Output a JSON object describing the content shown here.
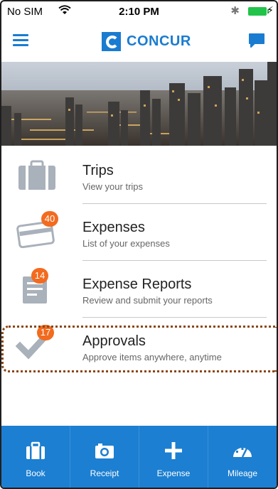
{
  "status_bar": {
    "carrier": "No SIM",
    "time": "2:10 PM",
    "bluetooth": "✱",
    "charging": "⚡"
  },
  "navbar": {
    "brand": "CONCUR",
    "menu_icon": "hamburger-menu-icon",
    "chat_icon": "chat-bubble-icon",
    "accent_color": "#1a7cd0"
  },
  "menu": {
    "items": [
      {
        "title": "Trips",
        "subtitle": "View your trips",
        "icon": "briefcase-icon",
        "badge": ""
      },
      {
        "title": "Expenses",
        "subtitle": "List of your expenses",
        "icon": "credit-card-icon",
        "badge": "40"
      },
      {
        "title": "Expense Reports",
        "subtitle": "Review and submit your reports",
        "icon": "report-icon",
        "badge": "14"
      },
      {
        "title": "Approvals",
        "subtitle": "Approve items anywhere, anytime",
        "icon": "checkmark-icon",
        "badge": "17"
      }
    ],
    "badge_color": "#f26b1f"
  },
  "tabbar": {
    "tabs": [
      {
        "label": "Book",
        "icon": "briefcase-icon"
      },
      {
        "label": "Receipt",
        "icon": "camera-icon"
      },
      {
        "label": "Expense",
        "icon": "plus-icon"
      },
      {
        "label": "Mileage",
        "icon": "speedometer-icon"
      }
    ],
    "background": "#1c7fd1"
  }
}
